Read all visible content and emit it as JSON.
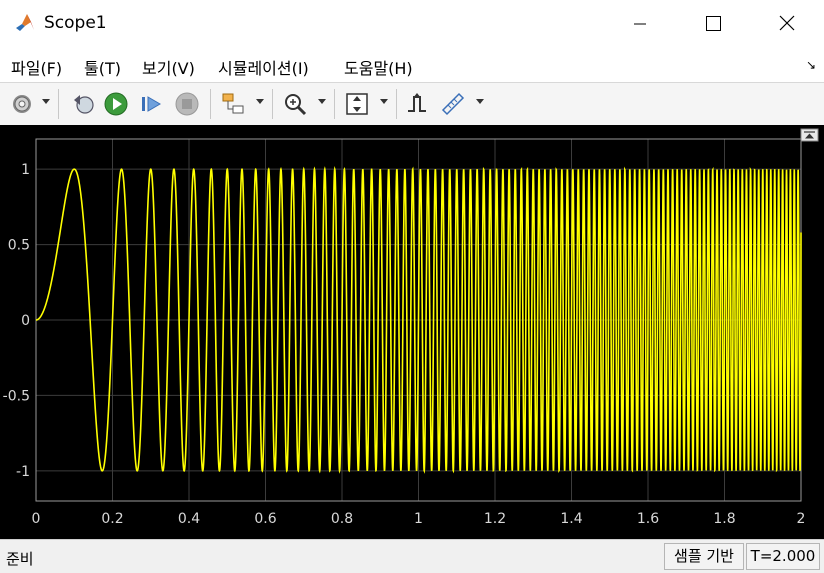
{
  "window": {
    "title": "Scope1"
  },
  "menu": {
    "items": [
      {
        "label": "파일(F)"
      },
      {
        "label": "툴(T)"
      },
      {
        "label": "보기(V)"
      },
      {
        "label": "시뮬레이션(I)"
      },
      {
        "label": "도움말(H)"
      }
    ]
  },
  "toolbar": {
    "icons": [
      "gear-icon",
      "back-step-icon",
      "run-icon",
      "step-forward-icon",
      "stop-icon",
      "highlight-block-icon",
      "zoom-icon",
      "scale-axes-icon",
      "triggers-icon",
      "measurements-icon"
    ]
  },
  "status": {
    "left": "준비",
    "mode": "샘플 기반",
    "time": "T=2.000"
  },
  "colors": {
    "signal": "#ffff00",
    "axes_bg": "#000000",
    "grid": "#3c3c3c",
    "tick_text": "#d8d8d8"
  },
  "chart_data": {
    "type": "line",
    "title": "",
    "xlabel": "",
    "ylabel": "",
    "xlim": [
      0,
      2
    ],
    "ylim": [
      -1.2,
      1.2
    ],
    "grid": true,
    "xticks": [
      0,
      0.2,
      0.4,
      0.6,
      0.8,
      1,
      1.2,
      1.4,
      1.6,
      1.8,
      2
    ],
    "xtick_labels": [
      "0",
      "0.2",
      "0.4",
      "0.6",
      "0.8",
      "1",
      "1.2",
      "1.4",
      "1.6",
      "1.8",
      "2"
    ],
    "yticks": [
      1,
      0.5,
      0,
      -0.5,
      -1
    ],
    "ytick_labels": [
      "1",
      "0.5",
      "0",
      "-0.5",
      "-1"
    ],
    "series": [
      {
        "signal": "sine sweep (chirp), frequency rising linearly over time",
        "amplitude": 1,
        "freq_start_hz": 0,
        "freq_at_end_hz": 100,
        "t_end": 2,
        "final_value": 0.58
      }
    ]
  }
}
